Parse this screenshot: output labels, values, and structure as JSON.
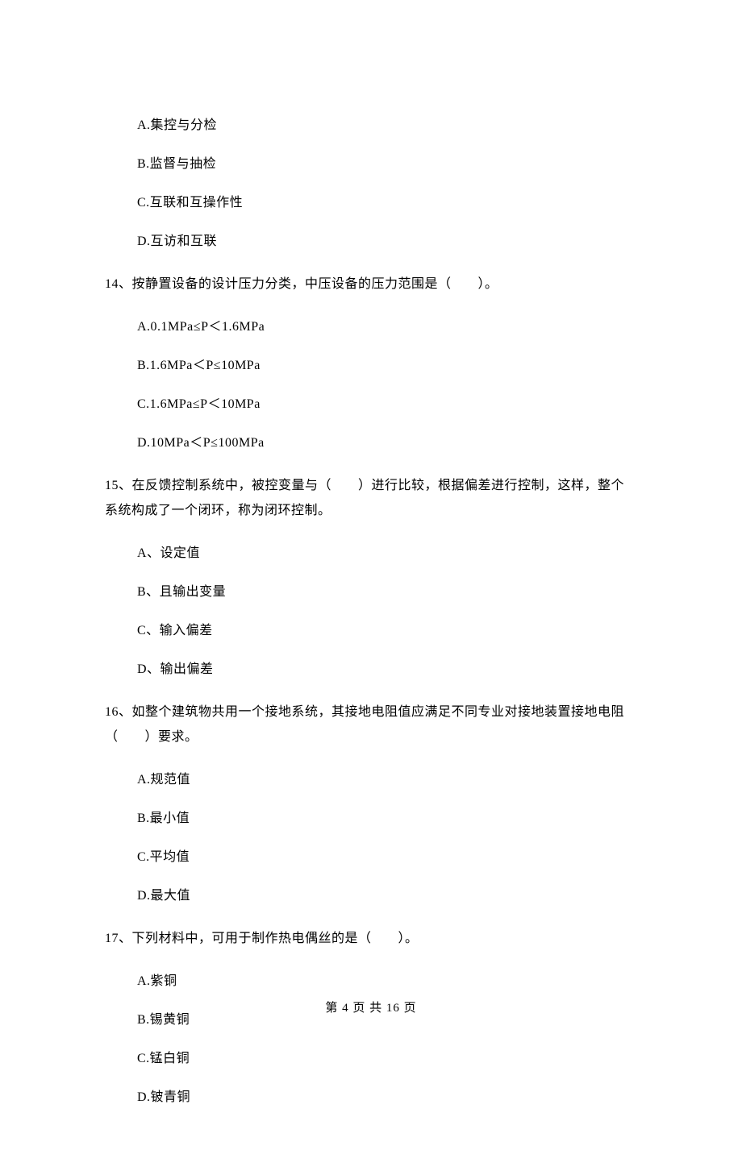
{
  "q13": {
    "options": {
      "A": "A.集控与分检",
      "B": "B.监督与抽检",
      "C": "C.互联和互操作性",
      "D": "D.互访和互联"
    }
  },
  "q14": {
    "text": "14、按静置设备的设计压力分类，中压设备的压力范围是（　　）。",
    "options": {
      "A": "A.0.1MPa≤P＜1.6MPa",
      "B": "B.1.6MPa＜P≤10MPa",
      "C": "C.1.6MPa≤P＜10MPa",
      "D": "D.10MPa＜P≤100MPa"
    }
  },
  "q15": {
    "text": "15、在反馈控制系统中，被控变量与（　　）进行比较，根据偏差进行控制，这样，整个系统构成了一个闭环，称为闭环控制。",
    "options": {
      "A": "A、设定值",
      "B": "B、且输出变量",
      "C": "C、输入偏差",
      "D": "D、输出偏差"
    }
  },
  "q16": {
    "text": "16、如整个建筑物共用一个接地系统，其接地电阻值应满足不同专业对接地装置接地电阻（　　）要求。",
    "options": {
      "A": "A.规范值",
      "B": "B.最小值",
      "C": "C.平均值",
      "D": "D.最大值"
    }
  },
  "q17": {
    "text": "17、下列材料中，可用于制作热电偶丝的是（　　）。",
    "options": {
      "A": "A.紫铜",
      "B": "B.锡黄铜",
      "C": "C.锰白铜",
      "D": "D.铍青铜"
    }
  },
  "footer": "第 4 页 共 16 页"
}
